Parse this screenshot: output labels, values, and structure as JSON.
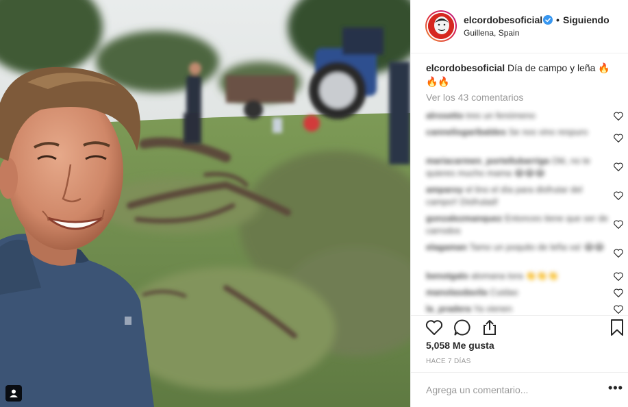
{
  "post": {
    "username": "elcordobesoficial",
    "separator": "•",
    "follow_status": "Siguiendo",
    "location": "Guillena, Spain",
    "caption": "Día de campo y leña 🔥🔥🔥",
    "view_comments": "Ver los 43 comentarios",
    "likes": "5,058 Me gusta",
    "time_ago": "HACE 7 DÍAS",
    "add_comment_placeholder": "Agrega un comentario...",
    "more_label": "•••"
  },
  "comments": [
    {
      "user": "alrosetto",
      "text": "tres un fenómeno"
    },
    {
      "user": "cannelisgaribaldes",
      "text": "Se nos vino respuro"
    },
    {
      "user": "mariacarmen_portellubarriga",
      "text": "Olé, no te quieres mucho mama 😂😂😂"
    },
    {
      "user": "amparoy",
      "text": "el lino el día para disfrutar del campo!! Disfrutad!"
    },
    {
      "user": "gonzalezmanquez",
      "text": "Entonces tiene que ser de carrodos"
    },
    {
      "user": "elagaman",
      "text": "Tamo un poquito de leña va! 😂😂"
    },
    {
      "user": "benotgalo",
      "text": "alomana tora 👏👏👏"
    },
    {
      "user": "manolasdavila",
      "text": "Cuidao"
    },
    {
      "user": "la_pradera",
      "text": "Ya vienen"
    }
  ],
  "icons": {
    "verified": "verified-badge-icon",
    "heart": "heart-icon",
    "comment": "comment-icon",
    "share": "share-icon",
    "bookmark": "bookmark-icon",
    "user_tag": "user-tag-icon"
  },
  "colors": {
    "verified_blue": "#3897f0",
    "muted_text": "#999999",
    "border": "#efefef"
  }
}
